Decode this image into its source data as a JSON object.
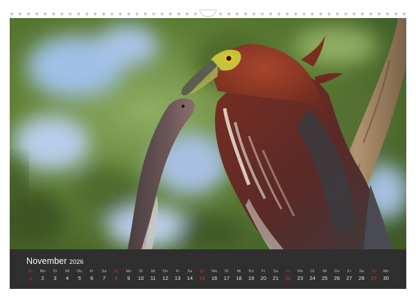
{
  "calendar": {
    "month": "November",
    "year": "2026",
    "sunday_color": "#d6322c",
    "days": [
      {
        "weekday": "So",
        "date": "1",
        "sunday": true
      },
      {
        "weekday": "Mo",
        "date": "2",
        "sunday": false
      },
      {
        "weekday": "Di",
        "date": "3",
        "sunday": false
      },
      {
        "weekday": "Mi",
        "date": "4",
        "sunday": false
      },
      {
        "weekday": "Do",
        "date": "5",
        "sunday": false
      },
      {
        "weekday": "Fr",
        "date": "6",
        "sunday": false
      },
      {
        "weekday": "Sa",
        "date": "7",
        "sunday": false
      },
      {
        "weekday": "So",
        "date": "8",
        "sunday": true
      },
      {
        "weekday": "Mo",
        "date": "9",
        "sunday": false
      },
      {
        "weekday": "Di",
        "date": "10",
        "sunday": false
      },
      {
        "weekday": "Mi",
        "date": "11",
        "sunday": false
      },
      {
        "weekday": "Do",
        "date": "12",
        "sunday": false
      },
      {
        "weekday": "Fr",
        "date": "13",
        "sunday": false
      },
      {
        "weekday": "Sa",
        "date": "14",
        "sunday": false
      },
      {
        "weekday": "So",
        "date": "15",
        "sunday": true
      },
      {
        "weekday": "Mo",
        "date": "16",
        "sunday": false
      },
      {
        "weekday": "Di",
        "date": "17",
        "sunday": false
      },
      {
        "weekday": "Mi",
        "date": "18",
        "sunday": false
      },
      {
        "weekday": "Do",
        "date": "19",
        "sunday": false
      },
      {
        "weekday": "Fr",
        "date": "20",
        "sunday": false
      },
      {
        "weekday": "Sa",
        "date": "21",
        "sunday": false
      },
      {
        "weekday": "So",
        "date": "22",
        "sunday": true
      },
      {
        "weekday": "Mo",
        "date": "23",
        "sunday": false
      },
      {
        "weekday": "Di",
        "date": "24",
        "sunday": false
      },
      {
        "weekday": "Mi",
        "date": "25",
        "sunday": false
      },
      {
        "weekday": "Do",
        "date": "26",
        "sunday": false
      },
      {
        "weekday": "Fr",
        "date": "27",
        "sunday": false
      },
      {
        "weekday": "Sa",
        "date": "28",
        "sunday": false
      },
      {
        "weekday": "So",
        "date": "29",
        "sunday": true
      },
      {
        "weekday": "Mo",
        "date": "30",
        "sunday": false
      }
    ]
  },
  "photo": {
    "subject": "heron-with-fish",
    "colors": {
      "background_green": "#6f8a3c",
      "background_blue": "#a9c3e6",
      "bird_chestnut": "#8c3424",
      "bird_dark": "#3e3a3c",
      "branch": "#9a7b5a",
      "fish": "#5b4a4a",
      "bill": "#c7c23a"
    }
  }
}
